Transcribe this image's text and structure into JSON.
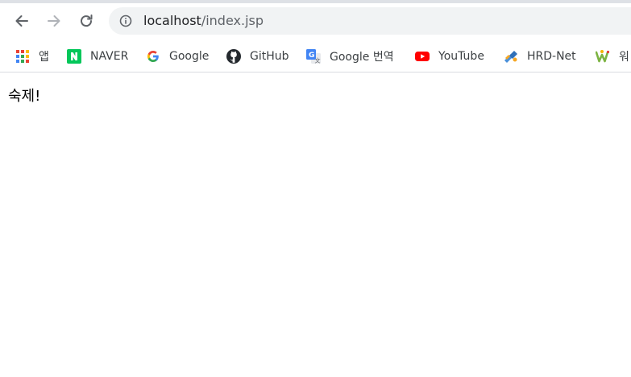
{
  "address_bar": {
    "host": "localhost",
    "path": "/index.jsp"
  },
  "bookmarks": [
    {
      "label": "앱",
      "icon": "apps-grid-icon"
    },
    {
      "label": "NAVER",
      "icon": "naver-icon"
    },
    {
      "label": "Google",
      "icon": "google-icon"
    },
    {
      "label": "GitHub",
      "icon": "github-icon"
    },
    {
      "label": "Google 번역",
      "icon": "google-translate-icon"
    },
    {
      "label": "YouTube",
      "icon": "youtube-icon"
    },
    {
      "label": "HRD-Net",
      "icon": "hrd-net-icon"
    },
    {
      "label": "워",
      "icon": "w-logo-icon"
    }
  ],
  "page": {
    "body_text": "숙제!"
  },
  "colors": {
    "toolbar_bg": "#ffffff",
    "omnibox_bg": "#f1f3f4",
    "naver_green": "#03c75a",
    "youtube_red": "#ff0000"
  }
}
